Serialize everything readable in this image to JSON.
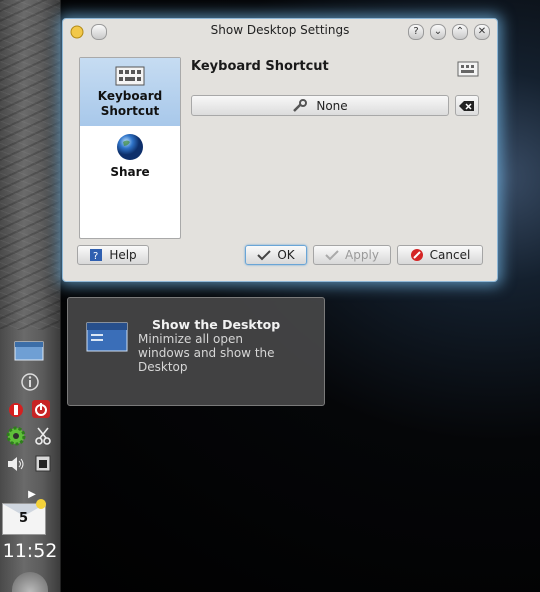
{
  "dialog": {
    "title": "Show Desktop Settings",
    "titlebar_buttons": [
      "?",
      "⌄",
      "⌃",
      "✕"
    ],
    "sidebar": {
      "items": [
        {
          "label_line1": "Keyboard",
          "label_line2": "Shortcut",
          "icon": "keyboard-icon",
          "selected": true
        },
        {
          "label": "Share",
          "icon": "globe-icon",
          "selected": false
        }
      ]
    },
    "section_title": "Keyboard Shortcut",
    "shortcut_value": "None",
    "buttons": {
      "help": "Help",
      "ok": "OK",
      "apply": "Apply",
      "cancel": "Cancel"
    }
  },
  "tooltip": {
    "title": "Show the Desktop",
    "description": "Minimize all open windows and show the Desktop"
  },
  "panel": {
    "mail_count": "5",
    "clock": "11:52"
  },
  "colors": {
    "selection": "#a8c8ea",
    "dialog_bg": "#e3e1dd",
    "glow": "#78bef0"
  }
}
